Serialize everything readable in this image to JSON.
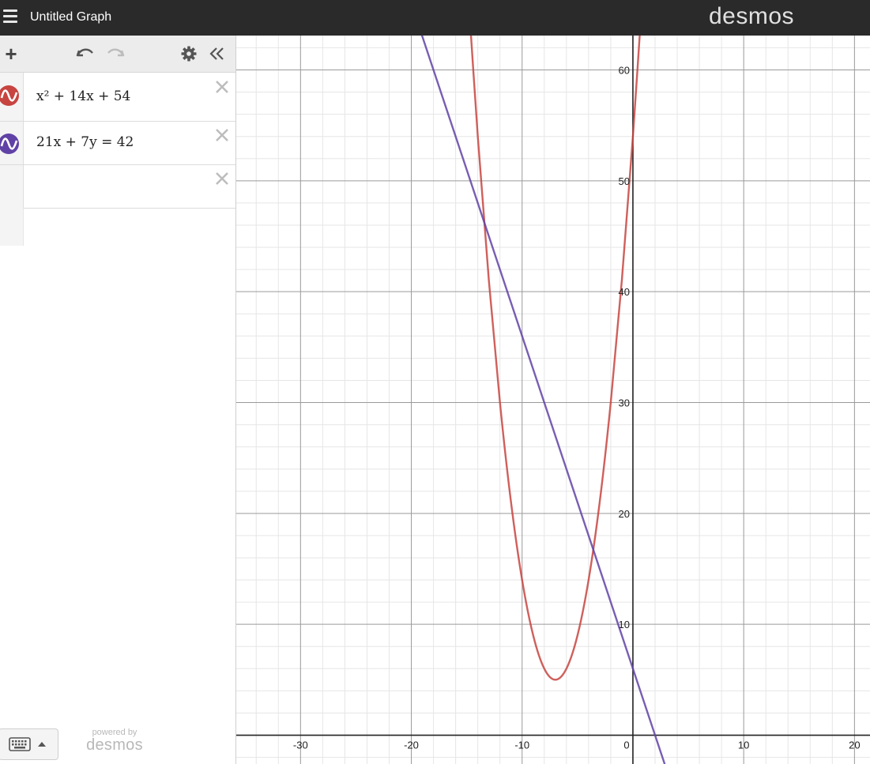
{
  "app": {
    "title": "Untitled Graph",
    "brand": "desmos"
  },
  "toolbar": {
    "add_label": "+",
    "icons": [
      "plus-icon",
      "undo-icon",
      "redo-icon",
      "gear-icon",
      "double-chevron-left-icon"
    ]
  },
  "expressions": [
    {
      "latex_display": "x² + 14x + 54",
      "color": "#c74440",
      "icon": "curve-icon"
    },
    {
      "latex_display": "21x + 7y = 42",
      "color": "#6042a6",
      "icon": "curve-icon"
    },
    {
      "latex_display": "",
      "color": "",
      "icon": ""
    }
  ],
  "footer": {
    "powered_by": "powered by",
    "brand": "desmos",
    "icons": [
      "keyboard-icon",
      "caret-up-icon"
    ]
  },
  "chart_data": {
    "type": "line",
    "title": "",
    "xlabel": "",
    "ylabel": "",
    "xlim": [
      -35.8,
      21.4
    ],
    "ylim": [
      -2.6,
      63.1
    ],
    "grid": true,
    "x_ticks": [
      "-30",
      "-20",
      "-10",
      "0",
      "10",
      "20"
    ],
    "y_ticks": [
      "10",
      "20",
      "30",
      "40",
      "50",
      "60"
    ],
    "series": [
      {
        "color": "#c74440",
        "x": [
          -15,
          -14,
          -13,
          -12,
          -11,
          -10,
          -9,
          -8,
          -7,
          -6,
          -5,
          -4,
          -3,
          -2,
          -1,
          0,
          1
        ],
        "y": [
          69,
          54,
          41,
          30,
          21,
          14,
          9,
          6,
          5,
          6,
          9,
          14,
          21,
          30,
          41,
          54,
          69
        ]
      },
      {
        "color": "#6042a6",
        "x": [
          -20,
          4
        ],
        "y": [
          66,
          -6
        ]
      }
    ]
  }
}
